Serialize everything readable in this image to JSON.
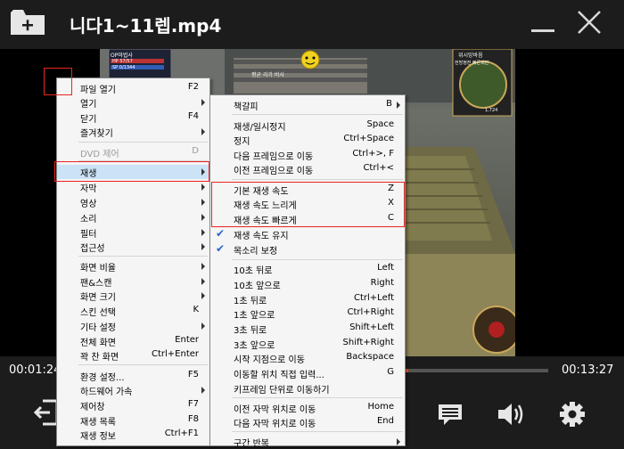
{
  "title": "니다1~11렙.mp4",
  "player": {
    "time_current": "00:01:24",
    "time_total": "00:13:27",
    "progress": 0.71
  },
  "game_overlay": {
    "class_label": "OP마법사",
    "hp": "HP 57/57",
    "sp": "SP 0/1344",
    "center_label": "평균 리가 버사",
    "minimap_title": "위시망바음",
    "minimap_sub": "전방정전 빠른회만",
    "minimap_value": "1,724"
  },
  "menu_main": {
    "items": [
      {
        "label": "파일 열기",
        "shortcut": "F2"
      },
      {
        "label": "열기",
        "submenu": true
      },
      {
        "label": "닫기",
        "shortcut": "F4"
      },
      {
        "label": "즐겨찾기",
        "submenu": true
      },
      {
        "label": "DVD 제어",
        "shortcut": "D",
        "disabled": true
      },
      {
        "label": "재생",
        "submenu": true,
        "highlight": true
      },
      {
        "label": "자막",
        "submenu": true
      },
      {
        "label": "영상",
        "submenu": true
      },
      {
        "label": "소리",
        "submenu": true
      },
      {
        "label": "필터",
        "submenu": true
      },
      {
        "label": "접근성",
        "submenu": true
      },
      {
        "label": "화면 비율",
        "submenu": true
      },
      {
        "label": "팬&스캔",
        "submenu": true
      },
      {
        "label": "화면 크기",
        "submenu": true
      },
      {
        "label": "스킨 선택",
        "shortcut": "K"
      },
      {
        "label": "기타 설정",
        "submenu": true
      },
      {
        "label": "전체 화면",
        "shortcut": "Enter"
      },
      {
        "label": "꽉 찬 화면",
        "shortcut": "Ctrl+Enter"
      },
      {
        "label": "환경 설정...",
        "shortcut": "F5"
      },
      {
        "label": "하드웨어 가속",
        "submenu": true
      },
      {
        "label": "제어창",
        "shortcut": "F7"
      },
      {
        "label": "재생 목록",
        "shortcut": "F8"
      },
      {
        "label": "재생 정보",
        "shortcut": "Ctrl+F1"
      }
    ]
  },
  "menu_play": {
    "items": [
      {
        "label": "책갈피",
        "shortcut": "B",
        "submenu": true
      },
      {
        "label": "재생/일시정지",
        "shortcut": "Space"
      },
      {
        "label": "정지",
        "shortcut": "Ctrl+Space"
      },
      {
        "label": "다음 프레임으로 이동",
        "shortcut": "Ctrl+>, F"
      },
      {
        "label": "이전 프레임으로 이동",
        "shortcut": "Ctrl+<"
      },
      {
        "label": "기본 재생 속도",
        "shortcut": "Z"
      },
      {
        "label": "재생 속도 느리게",
        "shortcut": "X"
      },
      {
        "label": "재생 속도 빠르게",
        "shortcut": "C"
      },
      {
        "label": "재생 속도 유지",
        "checked": true
      },
      {
        "label": "목소리 보정",
        "checked": true
      },
      {
        "label": "10초 뒤로",
        "shortcut": "Left"
      },
      {
        "label": "10초 앞으로",
        "shortcut": "Right"
      },
      {
        "label": "1초 뒤로",
        "shortcut": "Ctrl+Left"
      },
      {
        "label": "1초 앞으로",
        "shortcut": "Ctrl+Right"
      },
      {
        "label": "3초 뒤로",
        "shortcut": "Shift+Left"
      },
      {
        "label": "3초 앞으로",
        "shortcut": "Shift+Right"
      },
      {
        "label": "시작 지점으로 이동",
        "shortcut": "Backspace"
      },
      {
        "label": "이동할 위치 직접 입력...",
        "shortcut": "G"
      },
      {
        "label": "키프레임 단위로 이동하기"
      },
      {
        "label": "이전 자막 위치로 이동",
        "shortcut": "Home"
      },
      {
        "label": "다음 자막 위치로 이동",
        "shortcut": "End"
      },
      {
        "label": "구간 반복",
        "submenu": true
      }
    ]
  },
  "colors": {
    "accent": "#f25a2a",
    "highlight_box": "#e8261e",
    "menu_hover": "#cce3f7",
    "check": "#2a66c9"
  }
}
